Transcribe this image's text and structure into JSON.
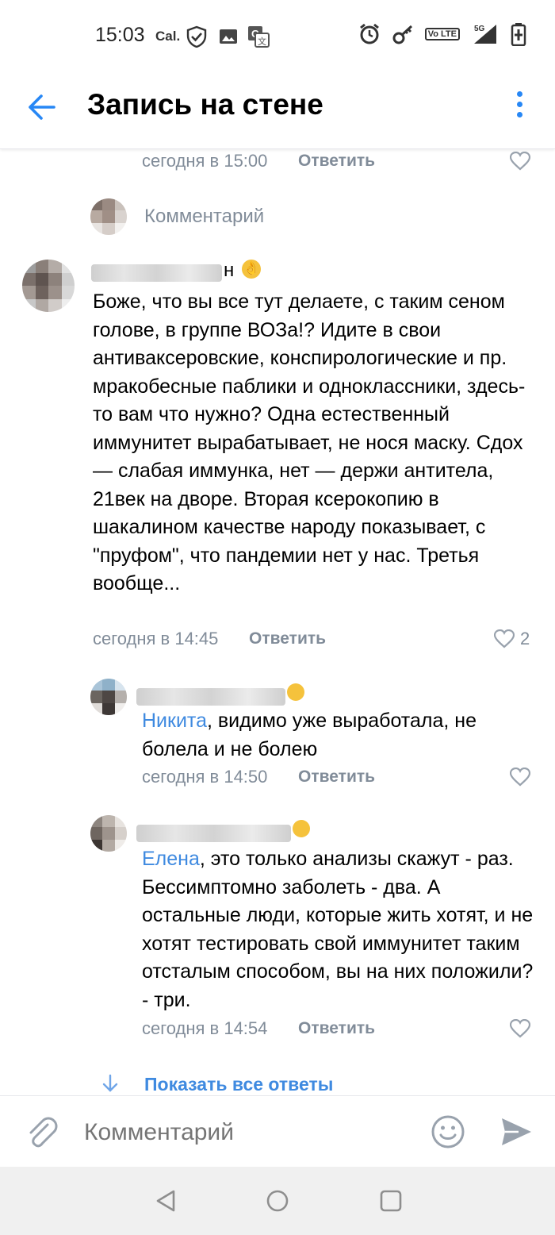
{
  "status_bar": {
    "time": "15:03",
    "carrier_label": "Cal.",
    "icons": [
      "shield-check-icon",
      "image-icon",
      "translate-icon",
      "alarm-icon",
      "key-icon",
      "volte-icon",
      "signal-5g-icon",
      "battery-charging-icon"
    ],
    "lte_label": "Vo LTE",
    "network_label": "5G"
  },
  "header": {
    "title": "Запись на стене",
    "back_icon": "arrow-left-icon",
    "menu_icon": "more-vertical-icon"
  },
  "comments": {
    "top_meta": {
      "time": "сегодня в 15:00",
      "reply": "Ответить"
    },
    "placeholder_row": {
      "label": "Комментарий"
    },
    "main": {
      "name_tail": "н",
      "text": "Боже,  что вы все тут делаете, с таким сеном  голове, в группе ВОЗа!? Идите в свои антиваксеровские, конспирологические и пр. мракобесные паблики и одноклассники, здесь-то вам что нужно? Одна естественный иммунитет вырабатывает, не нося маску. Сдох — слабая иммунка, нет — держи антитела, 21век на дворе. Вторая ксерокопию в шакалином качестве  народу показывает, с \"пруфом\", что пандемии нет у нас. Третья вообще...",
      "time": "сегодня в 14:45",
      "reply": "Ответить",
      "likes": "2"
    },
    "reply1": {
      "mention": "Никита",
      "text": ", видимо уже выработала, не болела и не болею",
      "time": "сегодня в 14:50",
      "reply": "Ответить"
    },
    "reply2": {
      "mention": "Елена",
      "text": ", это только анализы скажут - раз. Бессимптомно заболеть - два. А остальные люди, которые жить хотят, и не хотят тестировать свой иммунитет таким отсталым способом, вы на них положили? - три.",
      "time": "сегодня в 14:54",
      "reply": "Ответить"
    },
    "show_all": "Показать все ответы"
  },
  "composer": {
    "placeholder": "Комментарий"
  },
  "colors": {
    "accent": "#2787f5",
    "secondary_text": "#818c99",
    "link": "#3f8ae0"
  }
}
